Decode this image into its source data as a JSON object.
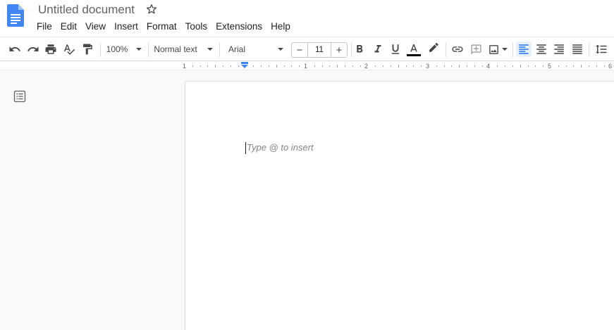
{
  "document": {
    "title": "Untitled document"
  },
  "menubar": {
    "items": [
      "File",
      "Edit",
      "View",
      "Insert",
      "Format",
      "Tools",
      "Extensions",
      "Help"
    ]
  },
  "toolbar": {
    "zoom": "100%",
    "style": "Normal text",
    "font": "Arial",
    "font_size": "11",
    "decrease_label": "−",
    "increase_label": "+"
  },
  "ruler": {
    "numbers": [
      "1",
      "1",
      "2",
      "3",
      "4",
      "5",
      "6"
    ]
  },
  "editor": {
    "placeholder": "Type @ to insert"
  },
  "colors": {
    "brand_blue": "#4285f4",
    "active_bg": "#e8f0fe",
    "text_color_bar": "#000000"
  },
  "icons": [
    "docs-logo-icon",
    "star-icon",
    "undo-icon",
    "redo-icon",
    "print-icon",
    "spellcheck-icon",
    "paint-format-icon",
    "bold-icon",
    "italic-icon",
    "underline-icon",
    "text-color-icon",
    "highlight-icon",
    "link-icon",
    "add-comment-icon",
    "insert-image-icon",
    "align-left-icon",
    "align-center-icon",
    "align-right-icon",
    "justify-icon",
    "line-spacing-icon",
    "outline-icon"
  ]
}
